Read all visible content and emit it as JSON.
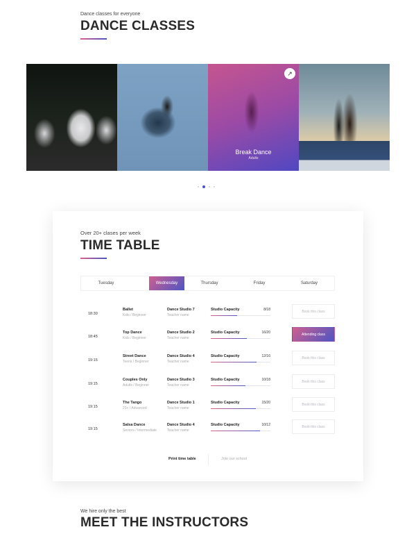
{
  "header": {
    "eyebrow": "Dance classes for everyone",
    "title": "DANCE CLASSES"
  },
  "carousel": {
    "slides": [
      {
        "name": "ballet",
        "image": "ballet-dancers-photo"
      },
      {
        "name": "contemporary",
        "image": "contemporary-dancer-photo"
      },
      {
        "name": "break-dance",
        "image": "break-dancer-photo",
        "title": "Break Dance",
        "subtitle": "Adults",
        "link_icon": "arrow-up-right-icon"
      },
      {
        "name": "couples",
        "image": "couple-dancers-photo"
      }
    ],
    "pagination": {
      "total": 4,
      "active_index": 1
    }
  },
  "timetable": {
    "eyebrow": "Over 20+ clases per week",
    "title": "TIME TABLE",
    "days": [
      {
        "label": "Tuesday",
        "active": false
      },
      {
        "label": "Wednesday",
        "active": true
      },
      {
        "label": "Thursday",
        "active": false
      },
      {
        "label": "Friday",
        "active": false
      },
      {
        "label": "Saturday",
        "active": false
      }
    ],
    "capacity_label": "Studio Capacity",
    "rows": [
      {
        "time": "18:30",
        "class": "Ballet",
        "level": "Kids / Beginner",
        "studio": "Dance Studio 7",
        "teacher": "Teacher name",
        "capacity": "8/18",
        "fill": 0.44,
        "action": "Book this class",
        "attending": false
      },
      {
        "time": "18:45",
        "class": "Top Dance",
        "level": "Kids / Beginner",
        "studio": "Dance Studio 2",
        "teacher": "Teacher name",
        "capacity": "16/20",
        "fill": 0.6,
        "action": "Attending class",
        "attending": true
      },
      {
        "time": "19:15",
        "class": "Street Dance",
        "level": "Teens / Beginner",
        "studio": "Dance Studio 4",
        "teacher": "Teacher name",
        "capacity": "12/16",
        "fill": 0.77,
        "action": "Book this class",
        "attending": false
      },
      {
        "time": "19:15",
        "class": "Couples Only",
        "level": "Adults / Beginner",
        "studio": "Dance Studio 3",
        "teacher": "Teacher name",
        "capacity": "10/18",
        "fill": 0.58,
        "action": "Book this class",
        "attending": false
      },
      {
        "time": "19:15",
        "class": "The Tango",
        "level": "21+ / Advanced",
        "studio": "Dance Studio 1",
        "teacher": "Teacher name",
        "capacity": "15/20",
        "fill": 0.75,
        "action": "Book this class",
        "attending": false
      },
      {
        "time": "19:15",
        "class": "Salsa Dance",
        "level": "Seniors / Intermediate",
        "studio": "Dance Studio 4",
        "teacher": "Teacher name",
        "capacity": "10/12",
        "fill": 0.83,
        "action": "Book this class",
        "attending": false
      }
    ],
    "footer": {
      "print_label": "Print time table",
      "join_label": "Join our school"
    }
  },
  "instructors": {
    "eyebrow": "We hire only the best",
    "title": "MEET THE INSTRUCTORS"
  },
  "colors": {
    "accent_start": "#d9618c",
    "accent_end": "#4a54c2"
  }
}
